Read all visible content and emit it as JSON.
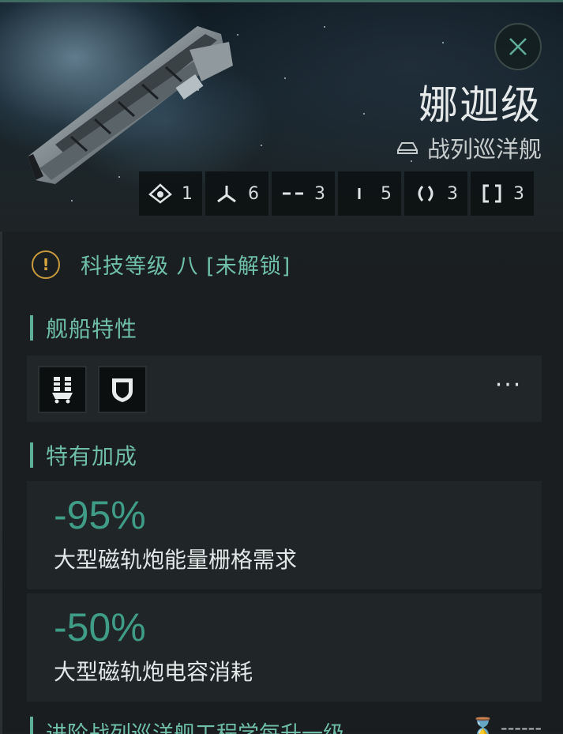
{
  "header": {
    "ship_name": "娜迦级",
    "ship_class": "战列巡洋舰",
    "close_icon": "close-icon",
    "class_icon": "battlecruiser-hull-icon"
  },
  "slots": [
    {
      "icon": "high-slot-icon",
      "value": "1"
    },
    {
      "icon": "turret-hardpoint-icon",
      "value": "6"
    },
    {
      "icon": "mid-slot-icon",
      "value": "3"
    },
    {
      "icon": "low-slot-icon",
      "value": "5"
    },
    {
      "icon": "rig-slot-icon",
      "value": "3"
    },
    {
      "icon": "drone-bay-icon",
      "value": "3"
    }
  ],
  "tech": {
    "icon": "warning-icon",
    "text": "科技等级 八 [未解锁]"
  },
  "traits": {
    "title": "舰船特性",
    "icons": [
      "railgun-skill-icon",
      "shield-skill-icon"
    ],
    "more_label": "···"
  },
  "bonuses": {
    "title": "特有加成",
    "items": [
      {
        "value": "-95%",
        "desc": "大型磁轨炮能量栅格需求"
      },
      {
        "value": "-50%",
        "desc": "大型磁轨炮电容消耗"
      }
    ]
  },
  "next_section": {
    "title": "进阶战列巡洋舰工程学每升一级",
    "right_text": "⌛ ------"
  },
  "colors": {
    "accent": "#6fbfa6",
    "bonus_value": "#3f9c86",
    "warning": "#d6a441",
    "background": "#1b1f21"
  }
}
